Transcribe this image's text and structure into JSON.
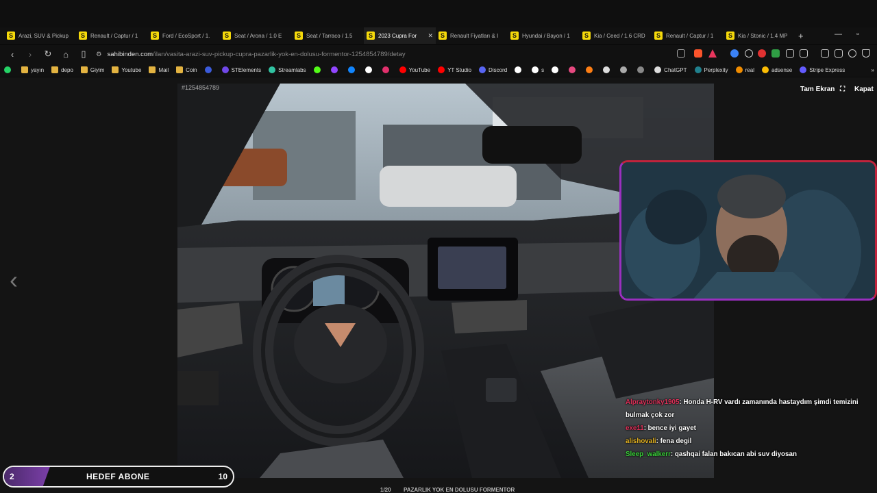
{
  "browser": {
    "tabs": [
      {
        "label": "Arazi, SUV & Pickup",
        "active": false
      },
      {
        "label": "Renault / Captur / 1",
        "active": false
      },
      {
        "label": "Ford / EcoSport / 1.",
        "active": false
      },
      {
        "label": "Seat / Arona / 1.0 E",
        "active": false
      },
      {
        "label": "Seat / Tarraco / 1.5",
        "active": false
      },
      {
        "label": "2023 Cupra For",
        "active": true
      },
      {
        "label": "Renault Fiyatları & I",
        "active": false
      },
      {
        "label": "Hyundai / Bayon / 1",
        "active": false
      },
      {
        "label": "Kia / Ceed / 1.6 CRD",
        "active": false
      },
      {
        "label": "Renault / Captur / 1",
        "active": false
      },
      {
        "label": "Kia / Stonic / 1.4 MP",
        "active": false
      }
    ],
    "tab_favicon_letter": "S",
    "new_tab_symbol": "+",
    "url_host": "sahibinden.com",
    "url_path": "/ilan/vasita-arazi-suv-pickup-cupra-pazarlik-yok-en-dolusu-formentor-1254854789/detay",
    "bookmarks": [
      {
        "label": "",
        "icon": "whatsapp-icon",
        "color": "#25d366"
      },
      {
        "label": "yayın",
        "icon": "folder-icon",
        "color": "#e3b341"
      },
      {
        "label": "depo",
        "icon": "folder-icon",
        "color": "#e3b341"
      },
      {
        "label": "Giyim",
        "icon": "folder-icon",
        "color": "#e3b341"
      },
      {
        "label": "Youtube",
        "icon": "folder-icon",
        "color": "#e3b341"
      },
      {
        "label": "Mail",
        "icon": "folder-icon",
        "color": "#e3b341"
      },
      {
        "label": "Coin",
        "icon": "folder-icon",
        "color": "#e3b341"
      },
      {
        "label": "",
        "icon": "r-icon",
        "color": "#3b5bdb"
      },
      {
        "label": "STElements",
        "icon": "stelements-icon",
        "color": "#7048e8"
      },
      {
        "label": "Streamlabs",
        "icon": "streamlabs-icon",
        "color": "#31c3a2"
      },
      {
        "label": "",
        "icon": "kick-icon",
        "color": "#53fc18"
      },
      {
        "label": "",
        "icon": "twitch-icon",
        "color": "#9146ff"
      },
      {
        "label": "",
        "icon": "bluesky-icon",
        "color": "#1185fe"
      },
      {
        "label": "",
        "icon": "x-icon",
        "color": "#ffffff"
      },
      {
        "label": "",
        "icon": "instagram-icon",
        "color": "#e1306c"
      },
      {
        "label": "YouTube",
        "icon": "youtube-icon",
        "color": "#ff0000"
      },
      {
        "label": "YT Studio",
        "icon": "yt-studio-icon",
        "color": "#ff0000"
      },
      {
        "label": "Discord",
        "icon": "discord-icon",
        "color": "#5865f2"
      },
      {
        "label": "",
        "icon": "tiktok-icon",
        "color": "#ffffff"
      },
      {
        "label": "s",
        "icon": "tiktok-icon",
        "color": "#ffffff"
      },
      {
        "label": "",
        "icon": "circle-icon",
        "color": "#ffffff"
      },
      {
        "label": "",
        "icon": "app-icon",
        "color": "#e64980"
      },
      {
        "label": "",
        "icon": "app-icon",
        "color": "#fd7e14"
      },
      {
        "label": "",
        "icon": "amazon-icon",
        "color": "#dddddd"
      },
      {
        "label": "",
        "icon": "app-icon",
        "color": "#aaaaaa"
      },
      {
        "label": "",
        "icon": "app-icon",
        "color": "#888888"
      },
      {
        "label": "ChatGPT",
        "icon": "chatgpt-icon",
        "color": "#dddddd"
      },
      {
        "label": "Perplexity",
        "icon": "perplexity-icon",
        "color": "#20808d"
      },
      {
        "label": "real",
        "icon": "real-icon",
        "color": "#f08c00"
      },
      {
        "label": "adsense",
        "icon": "adsense-icon",
        "color": "#fbbc04"
      },
      {
        "label": "Stripe Express",
        "icon": "stripe-icon",
        "color": "#635bff"
      }
    ]
  },
  "viewer": {
    "listing_id": "#1254854789",
    "fullscreen_label": "Tam Ekran",
    "close_label": "Kapat",
    "counter": "1/20",
    "caption": "PAZARLIK YOK EN DOLUSU FORMENTOR"
  },
  "overlay": {
    "chat": [
      {
        "user": "Alpraytonky1905",
        "user_color": "#e0315a",
        "text": ": Honda H-RV vardı zamanında hastaydım şimdi temizini bulmak çok zor"
      },
      {
        "user": "exe11",
        "user_color": "#e0315a",
        "text": ": bence iyi gayet"
      },
      {
        "user": "alishovali",
        "user_color": "#e6b422",
        "text": ": fena degil"
      },
      {
        "user": "Sleep_walkerr",
        "user_color": "#3ad13a",
        "text": ": qashqai falan bakıcan abi suv diyosan"
      }
    ],
    "goal": {
      "current": "2",
      "label": "HEDEF ABONE",
      "target": "10",
      "progress": 0.2
    }
  }
}
